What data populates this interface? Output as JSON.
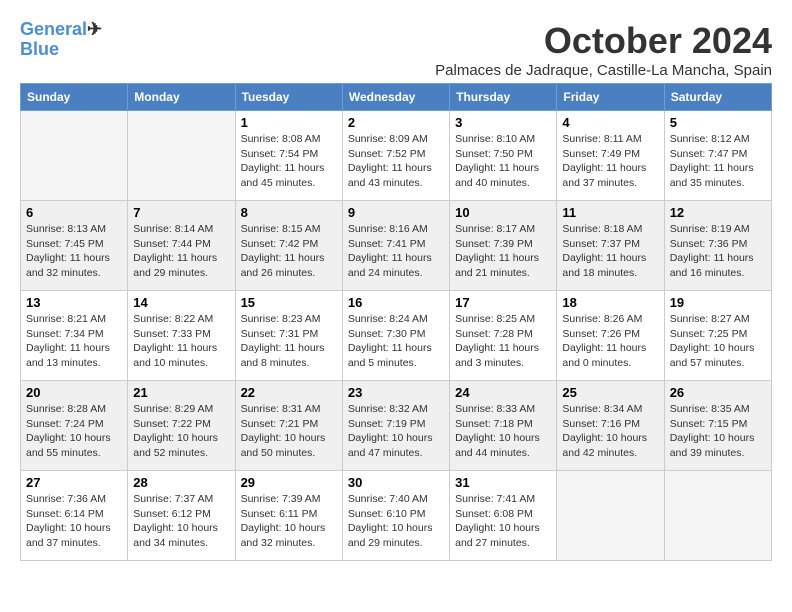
{
  "logo": {
    "text1": "General",
    "text2": "Blue"
  },
  "title": "October 2024",
  "subtitle": "Palmaces de Jadraque, Castille-La Mancha, Spain",
  "weekdays": [
    "Sunday",
    "Monday",
    "Tuesday",
    "Wednesday",
    "Thursday",
    "Friday",
    "Saturday"
  ],
  "weeks": [
    [
      {
        "day": "",
        "empty": true
      },
      {
        "day": "",
        "empty": true
      },
      {
        "day": "1",
        "sunrise": "8:08 AM",
        "sunset": "7:54 PM",
        "daylight": "11 hours and 45 minutes."
      },
      {
        "day": "2",
        "sunrise": "8:09 AM",
        "sunset": "7:52 PM",
        "daylight": "11 hours and 43 minutes."
      },
      {
        "day": "3",
        "sunrise": "8:10 AM",
        "sunset": "7:50 PM",
        "daylight": "11 hours and 40 minutes."
      },
      {
        "day": "4",
        "sunrise": "8:11 AM",
        "sunset": "7:49 PM",
        "daylight": "11 hours and 37 minutes."
      },
      {
        "day": "5",
        "sunrise": "8:12 AM",
        "sunset": "7:47 PM",
        "daylight": "11 hours and 35 minutes."
      }
    ],
    [
      {
        "day": "6",
        "sunrise": "8:13 AM",
        "sunset": "7:45 PM",
        "daylight": "11 hours and 32 minutes."
      },
      {
        "day": "7",
        "sunrise": "8:14 AM",
        "sunset": "7:44 PM",
        "daylight": "11 hours and 29 minutes."
      },
      {
        "day": "8",
        "sunrise": "8:15 AM",
        "sunset": "7:42 PM",
        "daylight": "11 hours and 26 minutes."
      },
      {
        "day": "9",
        "sunrise": "8:16 AM",
        "sunset": "7:41 PM",
        "daylight": "11 hours and 24 minutes."
      },
      {
        "day": "10",
        "sunrise": "8:17 AM",
        "sunset": "7:39 PM",
        "daylight": "11 hours and 21 minutes."
      },
      {
        "day": "11",
        "sunrise": "8:18 AM",
        "sunset": "7:37 PM",
        "daylight": "11 hours and 18 minutes."
      },
      {
        "day": "12",
        "sunrise": "8:19 AM",
        "sunset": "7:36 PM",
        "daylight": "11 hours and 16 minutes."
      }
    ],
    [
      {
        "day": "13",
        "sunrise": "8:21 AM",
        "sunset": "7:34 PM",
        "daylight": "11 hours and 13 minutes."
      },
      {
        "day": "14",
        "sunrise": "8:22 AM",
        "sunset": "7:33 PM",
        "daylight": "11 hours and 10 minutes."
      },
      {
        "day": "15",
        "sunrise": "8:23 AM",
        "sunset": "7:31 PM",
        "daylight": "11 hours and 8 minutes."
      },
      {
        "day": "16",
        "sunrise": "8:24 AM",
        "sunset": "7:30 PM",
        "daylight": "11 hours and 5 minutes."
      },
      {
        "day": "17",
        "sunrise": "8:25 AM",
        "sunset": "7:28 PM",
        "daylight": "11 hours and 3 minutes."
      },
      {
        "day": "18",
        "sunrise": "8:26 AM",
        "sunset": "7:26 PM",
        "daylight": "11 hours and 0 minutes."
      },
      {
        "day": "19",
        "sunrise": "8:27 AM",
        "sunset": "7:25 PM",
        "daylight": "10 hours and 57 minutes."
      }
    ],
    [
      {
        "day": "20",
        "sunrise": "8:28 AM",
        "sunset": "7:24 PM",
        "daylight": "10 hours and 55 minutes."
      },
      {
        "day": "21",
        "sunrise": "8:29 AM",
        "sunset": "7:22 PM",
        "daylight": "10 hours and 52 minutes."
      },
      {
        "day": "22",
        "sunrise": "8:31 AM",
        "sunset": "7:21 PM",
        "daylight": "10 hours and 50 minutes."
      },
      {
        "day": "23",
        "sunrise": "8:32 AM",
        "sunset": "7:19 PM",
        "daylight": "10 hours and 47 minutes."
      },
      {
        "day": "24",
        "sunrise": "8:33 AM",
        "sunset": "7:18 PM",
        "daylight": "10 hours and 44 minutes."
      },
      {
        "day": "25",
        "sunrise": "8:34 AM",
        "sunset": "7:16 PM",
        "daylight": "10 hours and 42 minutes."
      },
      {
        "day": "26",
        "sunrise": "8:35 AM",
        "sunset": "7:15 PM",
        "daylight": "10 hours and 39 minutes."
      }
    ],
    [
      {
        "day": "27",
        "sunrise": "7:36 AM",
        "sunset": "6:14 PM",
        "daylight": "10 hours and 37 minutes."
      },
      {
        "day": "28",
        "sunrise": "7:37 AM",
        "sunset": "6:12 PM",
        "daylight": "10 hours and 34 minutes."
      },
      {
        "day": "29",
        "sunrise": "7:39 AM",
        "sunset": "6:11 PM",
        "daylight": "10 hours and 32 minutes."
      },
      {
        "day": "30",
        "sunrise": "7:40 AM",
        "sunset": "6:10 PM",
        "daylight": "10 hours and 29 minutes."
      },
      {
        "day": "31",
        "sunrise": "7:41 AM",
        "sunset": "6:08 PM",
        "daylight": "10 hours and 27 minutes."
      },
      {
        "day": "",
        "empty": true
      },
      {
        "day": "",
        "empty": true
      }
    ]
  ]
}
